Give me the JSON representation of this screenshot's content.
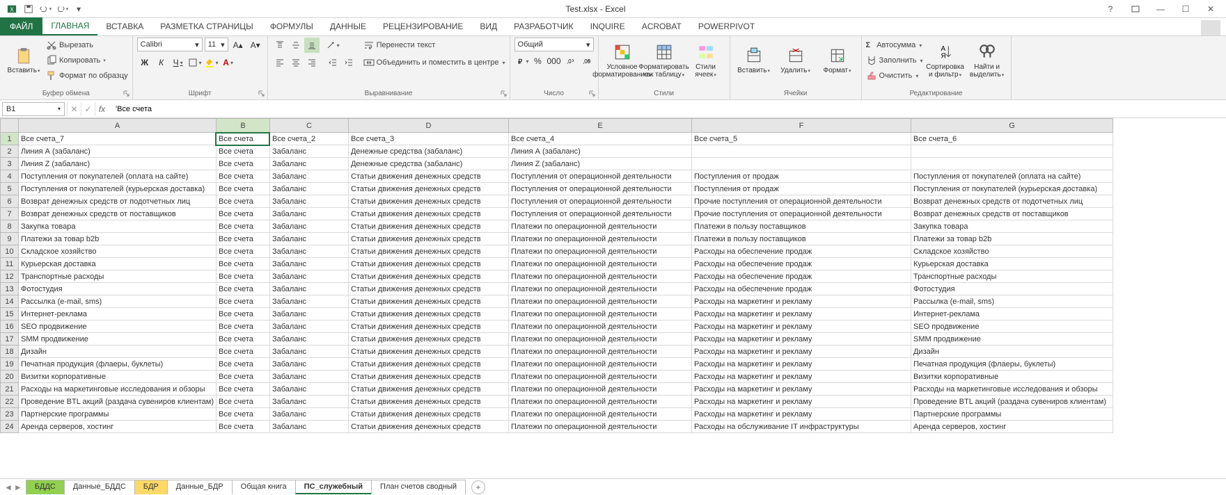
{
  "title": "Test.xlsx - Excel",
  "qat": {
    "excel": "icon",
    "save": "icon",
    "undo": "icon",
    "redo": "icon"
  },
  "tabs": {
    "file": "ФАЙЛ",
    "items": [
      "ГЛАВНАЯ",
      "ВСТАВКА",
      "РАЗМЕТКА СТРАНИЦЫ",
      "ФОРМУЛЫ",
      "ДАННЫЕ",
      "РЕЦЕНЗИРОВАНИЕ",
      "ВИД",
      "РАЗРАБОТЧИК",
      "INQUIRE",
      "ACROBAT",
      "POWERPIVOT"
    ],
    "active": 0
  },
  "ribbon": {
    "clipboard": {
      "paste": "Вставить",
      "cut": "Вырезать",
      "copy": "Копировать",
      "formatp": "Формат по образцу",
      "title": "Буфер обмена"
    },
    "font": {
      "name": "Calibri",
      "size": "11",
      "title": "Шрифт",
      "bold": "Ж",
      "italic": "К",
      "underline": "Ч"
    },
    "align": {
      "wrap": "Перенести текст",
      "merge": "Объединить и поместить в центре",
      "title": "Выравнивание"
    },
    "number": {
      "format": "Общий",
      "title": "Число"
    },
    "styles": {
      "cond": "Условное форматирование",
      "table": "Форматировать как таблицу",
      "cell": "Стили ячеек",
      "title": "Стили"
    },
    "cells": {
      "insert": "Вставить",
      "delete": "Удалить",
      "format": "Формат",
      "title": "Ячейки"
    },
    "editing": {
      "sum": "Автосумма",
      "fill": "Заполнить",
      "clear": "Очистить",
      "sort": "Сортировка и фильтр",
      "find": "Найти и выделить",
      "title": "Редактирование"
    }
  },
  "formulabar": {
    "name": "B1",
    "value": "'Все счета"
  },
  "columns": [
    "A",
    "B",
    "C",
    "D",
    "E",
    "F",
    "G"
  ],
  "selected": {
    "row": 1,
    "col": "B"
  },
  "rows": [
    {
      "n": 1,
      "c": [
        "Все счета_7",
        "Все счета",
        "Все счета_2",
        "Все счета_3",
        "Все счета_4",
        "Все счета_5",
        "Все счета_6"
      ]
    },
    {
      "n": 2,
      "c": [
        "Линия А (забаланс)",
        "Все счета",
        "Забаланс",
        "Денежные средства (забаланс)",
        "Линия А (забаланс)",
        "",
        ""
      ]
    },
    {
      "n": 3,
      "c": [
        "Линия Z (забаланс)",
        "Все счета",
        "Забаланс",
        "Денежные средства (забаланс)",
        "Линия Z (забаланс)",
        "",
        ""
      ]
    },
    {
      "n": 4,
      "c": [
        "Поступления от покупателей (оплата на сайте)",
        "Все счета",
        "Забаланс",
        "Статьи движения денежных средств",
        "Поступления от операционной деятельности",
        "Поступления от продаж",
        "Поступления от покупателей (оплата на сайте)"
      ]
    },
    {
      "n": 5,
      "c": [
        "Поступления от покупателей (курьерская доставка)",
        "Все счета",
        "Забаланс",
        "Статьи движения денежных средств",
        "Поступления от операционной деятельности",
        "Поступления от продаж",
        "Поступления от покупателей (курьерская доставка)"
      ]
    },
    {
      "n": 6,
      "c": [
        "Возврат денежных средств от подотчетных лиц",
        "Все счета",
        "Забаланс",
        "Статьи движения денежных средств",
        "Поступления от операционной деятельности",
        "Прочие поступления от операционной деятельности",
        "Возврат денежных средств от подотчетных лиц"
      ]
    },
    {
      "n": 7,
      "c": [
        "Возврат денежных средств от поставщиков",
        "Все счета",
        "Забаланс",
        "Статьи движения денежных средств",
        "Поступления от операционной деятельности",
        "Прочие поступления от операционной деятельности",
        "Возврат денежных средств от поставщиков"
      ]
    },
    {
      "n": 8,
      "c": [
        "Закупка товара",
        "Все счета",
        "Забаланс",
        "Статьи движения денежных средств",
        "Платежи по операционной деятельности",
        "Платежи в пользу поставщиков",
        "Закупка товара"
      ]
    },
    {
      "n": 9,
      "c": [
        "Платежи за товар b2b",
        "Все счета",
        "Забаланс",
        "Статьи движения денежных средств",
        "Платежи по операционной деятельности",
        "Платежи в пользу поставщиков",
        "Платежи за товар b2b"
      ]
    },
    {
      "n": 10,
      "c": [
        "Складское хозяйство",
        "Все счета",
        "Забаланс",
        "Статьи движения денежных средств",
        "Платежи по операционной деятельности",
        "Расходы на обеспечение продаж",
        "Складское хозяйство"
      ]
    },
    {
      "n": 11,
      "c": [
        "Курьерская доставка",
        "Все счета",
        "Забаланс",
        "Статьи движения денежных средств",
        "Платежи по операционной деятельности",
        "Расходы на обеспечение продаж",
        "Курьерская доставка"
      ]
    },
    {
      "n": 12,
      "c": [
        "Транспортные расходы",
        "Все счета",
        "Забаланс",
        "Статьи движения денежных средств",
        "Платежи по операционной деятельности",
        "Расходы на обеспечение продаж",
        "Транспортные расходы"
      ]
    },
    {
      "n": 13,
      "c": [
        "Фотостудия",
        "Все счета",
        "Забаланс",
        "Статьи движения денежных средств",
        "Платежи по операционной деятельности",
        "Расходы на обеспечение продаж",
        "Фотостудия"
      ]
    },
    {
      "n": 14,
      "c": [
        "Рассылка (e-mail, sms)",
        "Все счета",
        "Забаланс",
        "Статьи движения денежных средств",
        "Платежи по операционной деятельности",
        "Расходы на маркетинг и рекламу",
        "Рассылка (e-mail, sms)"
      ]
    },
    {
      "n": 15,
      "c": [
        "Интернет-реклама",
        "Все счета",
        "Забаланс",
        "Статьи движения денежных средств",
        "Платежи по операционной деятельности",
        "Расходы на маркетинг и рекламу",
        "Интернет-реклама"
      ]
    },
    {
      "n": 16,
      "c": [
        "SEO продвижение",
        "Все счета",
        "Забаланс",
        "Статьи движения денежных средств",
        "Платежи по операционной деятельности",
        "Расходы на маркетинг и рекламу",
        "SEO продвижение"
      ]
    },
    {
      "n": 17,
      "c": [
        "SMM продвижение",
        "Все счета",
        "Забаланс",
        "Статьи движения денежных средств",
        "Платежи по операционной деятельности",
        "Расходы на маркетинг и рекламу",
        "SMM продвижение"
      ]
    },
    {
      "n": 18,
      "c": [
        "Дизайн",
        "Все счета",
        "Забаланс",
        "Статьи движения денежных средств",
        "Платежи по операционной деятельности",
        "Расходы на маркетинг и рекламу",
        "Дизайн"
      ]
    },
    {
      "n": 19,
      "c": [
        "Печатная продукция (флаеры, буклеты)",
        "Все счета",
        "Забаланс",
        "Статьи движения денежных средств",
        "Платежи по операционной деятельности",
        "Расходы на маркетинг и рекламу",
        "Печатная продукция (флаеры, буклеты)"
      ]
    },
    {
      "n": 20,
      "c": [
        "Визитки корпоративные",
        "Все счета",
        "Забаланс",
        "Статьи движения денежных средств",
        "Платежи по операционной деятельности",
        "Расходы на маркетинг и рекламу",
        "Визитки корпоративные"
      ]
    },
    {
      "n": 21,
      "c": [
        "Расходы на маркетинговые исследования и обзоры",
        "Все счета",
        "Забаланс",
        "Статьи движения денежных средств",
        "Платежи по операционной деятельности",
        "Расходы на маркетинг и рекламу",
        "Расходы на маркетинговые исследования и обзоры"
      ]
    },
    {
      "n": 22,
      "c": [
        "Проведение BTL акций (раздача сувениров клиентам)",
        "Все счета",
        "Забаланс",
        "Статьи движения денежных средств",
        "Платежи по операционной деятельности",
        "Расходы на маркетинг и рекламу",
        "Проведение BTL акций (раздача сувениров клиентам)"
      ]
    },
    {
      "n": 23,
      "c": [
        "Партнерские программы",
        "Все счета",
        "Забаланс",
        "Статьи движения денежных средств",
        "Платежи по операционной деятельности",
        "Расходы на маркетинг и рекламу",
        "Партнерские программы"
      ]
    },
    {
      "n": 24,
      "c": [
        "Аренда серверов, хостинг",
        "Все счета",
        "Забаланс",
        "Статьи движения денежных средств",
        "Платежи по операционной деятельности",
        "Расходы на обслуживание IT инфраструктуры",
        "Аренда серверов, хостинг"
      ]
    }
  ],
  "sheets": [
    {
      "name": "БДДС",
      "cls": "green"
    },
    {
      "name": "Данные_БДДС",
      "cls": ""
    },
    {
      "name": "БДР",
      "cls": "yellow"
    },
    {
      "name": "Данные_БДР",
      "cls": ""
    },
    {
      "name": "Общая книга",
      "cls": ""
    },
    {
      "name": "ПС_служебный",
      "cls": "active"
    },
    {
      "name": "План счетов сводный",
      "cls": ""
    }
  ]
}
